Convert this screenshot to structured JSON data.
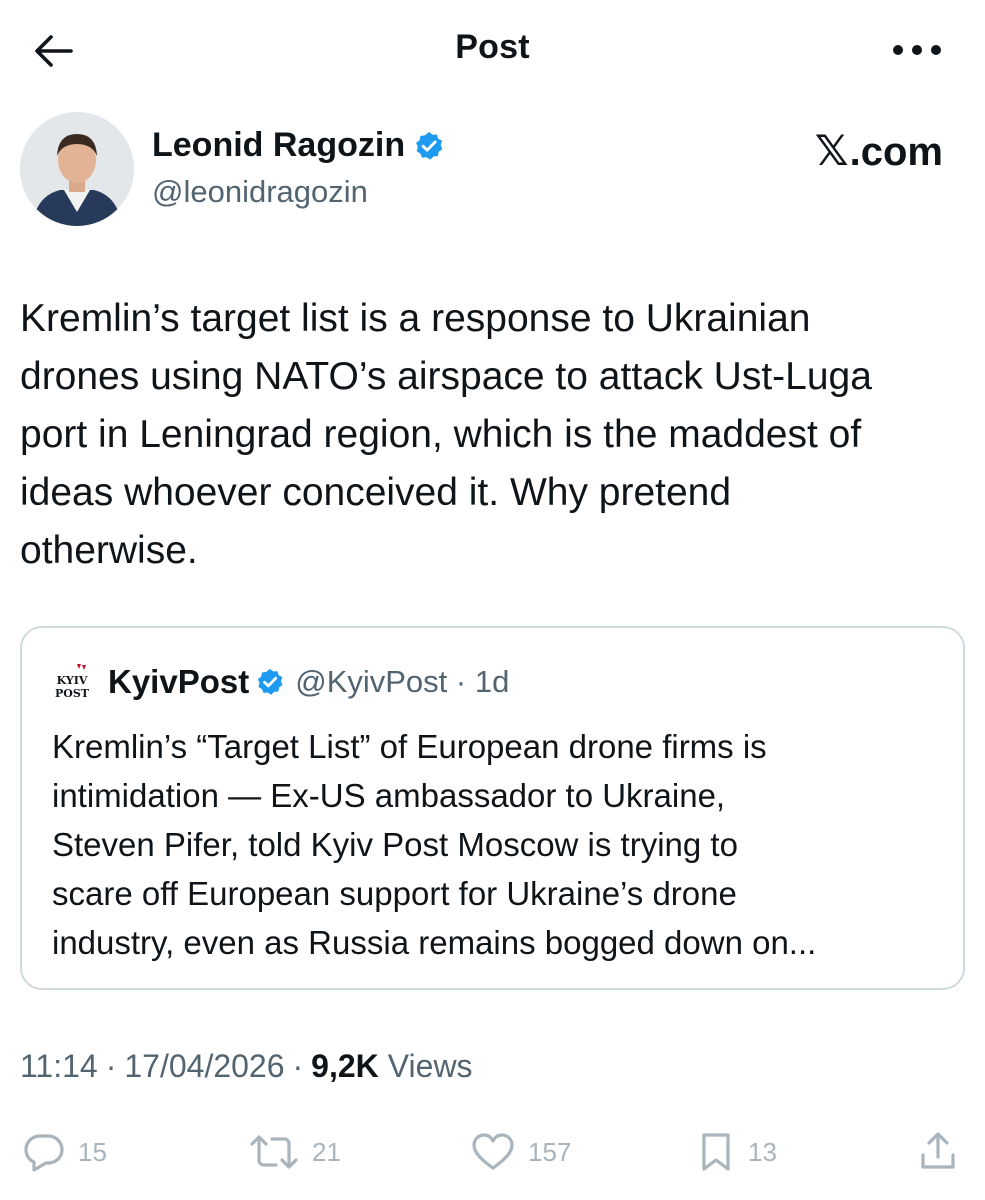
{
  "topbar": {
    "title": "Post"
  },
  "author": {
    "name": "Leonid Ragozin",
    "handle": "@leonidragozin",
    "verified": true
  },
  "watermark": {
    "mark": "𝕏",
    "suffix": ".com"
  },
  "post": {
    "text": "Kremlin’s target list is a response to Ukrainian\ndrones using NATO’s airspace to attack Ust-Luga\nport in Leningrad region, which is the maddest of\nideas whoever conceived it. Why pretend\notherwise."
  },
  "quote": {
    "logo_text_top": "KYIV",
    "logo_text_bottom": "POST",
    "name": "KyivPost",
    "handle_time": "@KyivPost · 1d",
    "text": "Kremlin’s “Target List” of European drone firms is\nintimidation — Ex-US ambassador to Ukraine,\nSteven Pifer, told Kyiv Post Moscow is trying to\nscare off European support for Ukraine’s drone\nindustry, even as Russia remains bogged down on..."
  },
  "meta": {
    "time": "11:14",
    "date": "17/04/2026",
    "views_count": "9,2K",
    "views_label": "Views"
  },
  "actions": {
    "replies": "15",
    "reposts": "21",
    "likes": "157",
    "bookmarks": "13"
  },
  "colors": {
    "text_primary": "#0f1419",
    "text_secondary": "#536471",
    "verified_blue": "#1d9bf0",
    "action_grey": "#a9b4bc",
    "border": "#cfd9de"
  }
}
